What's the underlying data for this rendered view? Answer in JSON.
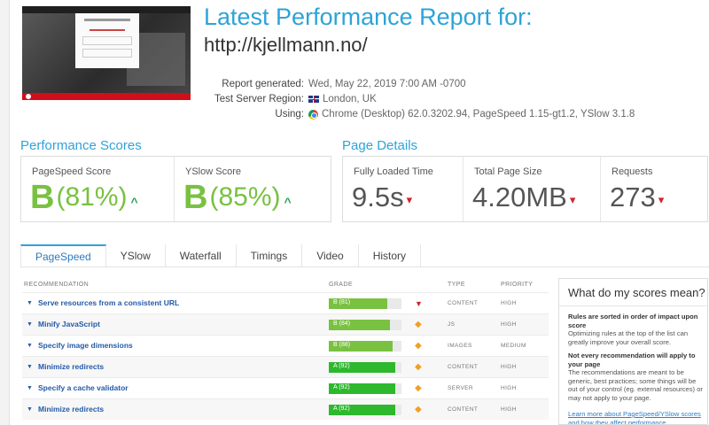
{
  "report": {
    "title": "Latest Performance Report for:",
    "url": "http://kjellmann.no/"
  },
  "meta": {
    "generated_label": "Report generated:",
    "generated_value": "Wed, May 22, 2019 7:00 AM -0700",
    "region_label": "Test Server Region:",
    "region_value": "London, UK",
    "region_icon": "uk-flag-icon",
    "using_label": "Using:",
    "using_value": "Chrome (Desktop) 62.0.3202.94, PageSpeed 1.15-gt1.2, YSlow 3.1.8",
    "using_icon": "chrome-icon"
  },
  "performance": {
    "heading": "Performance Scores",
    "pagespeed": {
      "label": "PageSpeed Score",
      "grade": "B",
      "percent": "(81%)",
      "trend": "up"
    },
    "yslow": {
      "label": "YSlow Score",
      "grade": "B",
      "percent": "(85%)",
      "trend": "up"
    }
  },
  "details": {
    "heading": "Page Details",
    "loaded": {
      "label": "Fully Loaded Time",
      "value": "9.5s",
      "trend": "down"
    },
    "size": {
      "label": "Total Page Size",
      "value": "4.20MB",
      "trend": "down"
    },
    "requests": {
      "label": "Requests",
      "value": "273",
      "trend": "down"
    }
  },
  "tabs": [
    {
      "label": "PageSpeed",
      "active": true
    },
    {
      "label": "YSlow",
      "active": false
    },
    {
      "label": "Waterfall",
      "active": false
    },
    {
      "label": "Timings",
      "active": false
    },
    {
      "label": "Video",
      "active": false
    },
    {
      "label": "History",
      "active": false
    }
  ],
  "table": {
    "headers": {
      "recommendation": "RECOMMENDATION",
      "grade": "GRADE",
      "type": "TYPE",
      "priority": "PRIORITY"
    },
    "rows": [
      {
        "rec": "Serve resources from a consistent URL",
        "grade": "B (81)",
        "score": 81,
        "indicator": "down",
        "type": "CONTENT",
        "priority": "HIGH"
      },
      {
        "rec": "Minify JavaScript",
        "grade": "B (84)",
        "score": 84,
        "indicator": "diamond",
        "type": "JS",
        "priority": "HIGH"
      },
      {
        "rec": "Specify image dimensions",
        "grade": "B (88)",
        "score": 88,
        "indicator": "diamond",
        "type": "IMAGES",
        "priority": "MEDIUM"
      },
      {
        "rec": "Minimize redirects",
        "grade": "A (92)",
        "score": 92,
        "indicator": "diamond",
        "type": "CONTENT",
        "priority": "HIGH"
      },
      {
        "rec": "Specify a cache validator",
        "grade": "A (92)",
        "score": 92,
        "indicator": "diamond",
        "type": "SERVER",
        "priority": "HIGH"
      },
      {
        "rec": "Minimize redirects",
        "grade": "A (92)",
        "score": 92,
        "indicator": "diamond",
        "type": "CONTENT",
        "priority": "HIGH"
      }
    ]
  },
  "sidebar": {
    "title": "What do my scores mean?",
    "p1_bold": "Rules are sorted in order of impact upon score",
    "p1": "Optimizing rules at the top of the list can greatly improve your overall score.",
    "p2_bold": "Not every recommendation will apply to your page",
    "p2": "The recommendations are meant to be generic, best practices; some things will be out of your control (eg. external resources) or may not apply to your page.",
    "link": "Learn more about PageSpeed/YSlow scores and how they affect performance."
  },
  "colors": {
    "accent": "#2ea3d8",
    "grade_b": "#79c141",
    "grade_a": "#2db82d",
    "trend_up": "#2fa05a",
    "trend_down": "#d0232c",
    "indicator_diamond": "#f0a020"
  }
}
